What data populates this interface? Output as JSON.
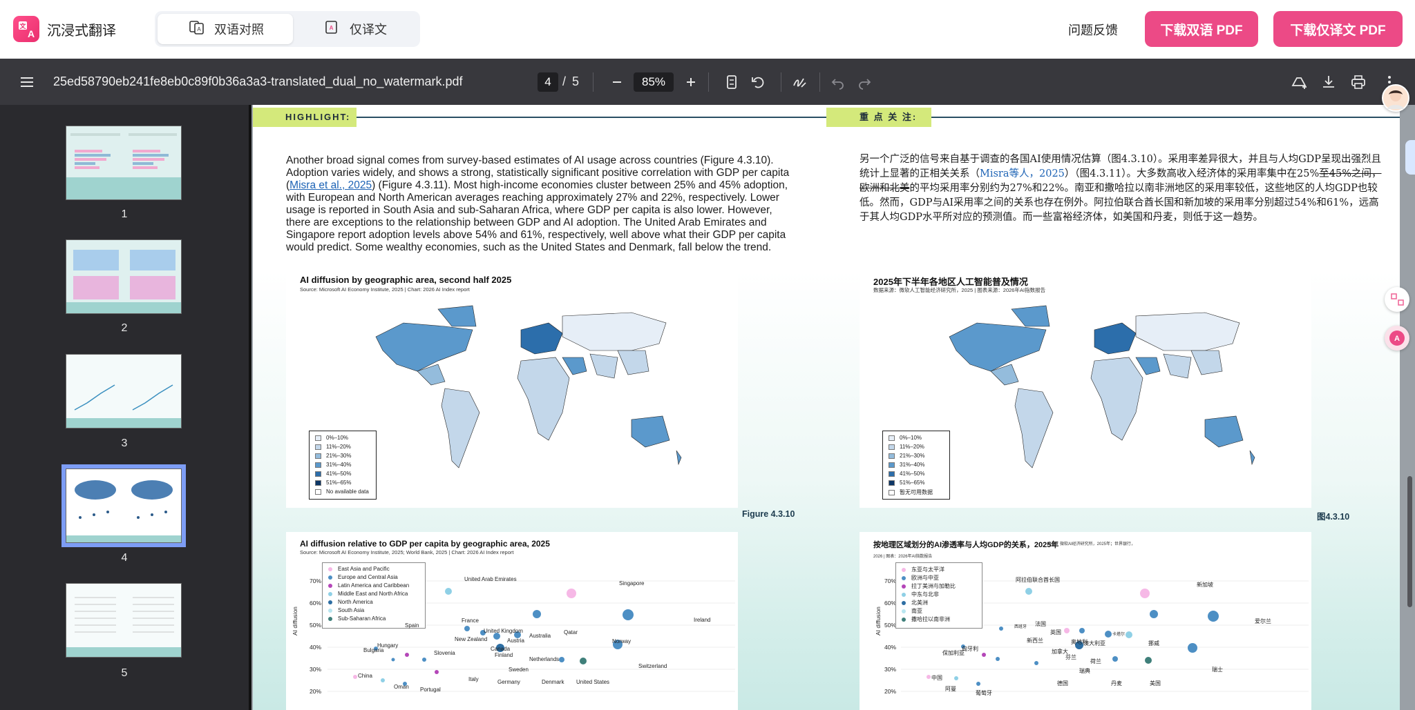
{
  "app": {
    "name": "沉浸式翻译",
    "modes": [
      {
        "label": "双语对照",
        "active": true
      },
      {
        "label": "仅译文",
        "active": false
      }
    ],
    "feedback_label": "问题反馈",
    "download_bilingual_label": "下载双语 PDF",
    "download_translated_label": "下载仅译文 PDF",
    "accent_color": "#ec4a86"
  },
  "viewer": {
    "filename": "25ed58790eb241fe8eb0c89f0b36a3a3-translated_dual_no_watermark.pdf",
    "current_page": "4",
    "page_separator": "/",
    "total_pages": "5",
    "zoom": "85%",
    "icons": [
      "menu-icon",
      "zoom-out-icon",
      "zoom-in-icon",
      "page-fit-icon",
      "rotate-icon",
      "draw-icon",
      "undo-icon",
      "redo-icon",
      "add-drive-icon",
      "download-icon",
      "print-icon",
      "more-icon"
    ]
  },
  "thumbnails": [
    {
      "label": "1",
      "selected": false
    },
    {
      "label": "2",
      "selected": false
    },
    {
      "label": "3",
      "selected": false
    },
    {
      "label": "4",
      "selected": true
    },
    {
      "label": "5",
      "selected": false
    }
  ],
  "document": {
    "highlight_en": "HIGHLIGHT:",
    "highlight_zh": "重 点 关 注:",
    "para_en": {
      "before_link": "Another broad signal comes from survey-based estimates of AI usage across countries (Figure 4.3.10). Adoption varies widely, and shows a strong, statistically significant positive correlation with GDP per capita (",
      "link": "Misra et al., 2025",
      "after_link": ") (Figure 4.3.11). Most high-income economies cluster between 25% and 45% adoption, with European and North American averages reaching approximately 27% and 22%, respectively. Lower usage is reported in South Asia and sub-Saharan Africa, where GDP per capita is also lower. However, there are exceptions to the relationship between GDP and AI adoption. The United Arab Emirates and Singapore report adoption levels above 54% and 61%, respectively, well above what their GDP per capita would predict. Some wealthy economies, such as the United States and Denmark, fall below the trend."
    },
    "para_zh": {
      "before_link": "另一个广泛的信号来自基于调查的各国AI使用情况估算（图4.3.10）。采用率差异很大，并且与人均GDP呈现出强烈且统计上显著的正相关关系（",
      "link": "Misra等人，2025",
      "middle": "）（图4.3.11）。大多数高收入经济体的采用率集中在25%",
      "struck": "至45%之间，欧洲和北美",
      "after": "的平均采用率分别约为27%和22%。南亚和撒哈拉以南非洲地区的采用率较低，这些地区的人均GDP也较低。然而，GDP与AI采用率之间的关系也存在例外。阿拉伯联合酋长国和新加坡的采用率分别超过54%和61%，远高于其人均GDP水平所对应的预测值。而一些富裕经济体，如美国和丹麦，则低于这一趋势。"
    },
    "figure_10_en": {
      "title": "AI diffusion by geographic area, second half 2025",
      "source": "Source: Microsoft AI Economy Institute, 2025 | Chart: 2026 AI Index report",
      "legend": [
        "0%–10%",
        "11%–20%",
        "21%–30%",
        "31%–40%",
        "41%–50%",
        "51%–65%",
        "No available data"
      ],
      "caption": "Figure 4.3.10"
    },
    "figure_10_zh": {
      "title": "2025年下半年各地区人工智能普及情况",
      "source": "数据来源：微软人工智能经济研究所，2025 | 图表来源：2026年AI指数报告",
      "legend": [
        "0%–10%",
        "11%–20%",
        "21%–30%",
        "31%–40%",
        "41%–50%",
        "51%–65%",
        "暂无可用数据"
      ],
      "caption": "图4.3.10"
    },
    "legend_colors": [
      "#e6eef7",
      "#c3d7ea",
      "#94bcdc",
      "#5b99cc",
      "#2c6eab",
      "#0d3666",
      "#ffffff"
    ],
    "figure_11_en": {
      "title": "AI diffusion relative to GDP per capita by geographic area, 2025",
      "source": "Source: Microsoft AI Economy Institute, 2025; World Bank, 2025 | Chart: 2026 AI Index report",
      "legend": [
        "East Asia and Pacific",
        "Europe and Central Asia",
        "Latin America and Caribbean",
        "Middle East and North Africa",
        "North America",
        "South Asia",
        "Sub-Saharan Africa"
      ],
      "ylabel": "AI diffusion",
      "yticks": [
        "70%",
        "60%",
        "50%",
        "40%",
        "30%",
        "20%"
      ],
      "labels": [
        "United Arab Emirates",
        "Singapore",
        "Ireland",
        "France",
        "Spain",
        "United Kingdom",
        "Australia",
        "Qatar",
        "New Zealand",
        "Austria",
        "Norway",
        "Hungary",
        "Canada",
        "Bulgaria",
        "Finland",
        "Slovenia",
        "Netherlands",
        "Sweden",
        "Switzerland",
        "China",
        "Italy",
        "Germany",
        "Denmark",
        "United States",
        "Oman",
        "Portugal"
      ]
    },
    "figure_11_zh": {
      "title": "按地理区域划分的AI渗透率与人均GDP的关系，2025年",
      "source": "来源：微软AI经济研究所，2025年；世界银行，",
      "source2": "2026 | 图表：2026年AI指数报告",
      "legend": [
        "东亚与太平洋",
        "欧洲与中亚",
        "拉丁美洲与加勒比",
        "中东与北非",
        "北美洲",
        "南亚",
        "撒哈拉以南非洲"
      ],
      "ylabel": "AI diffusion",
      "yticks": [
        "70%",
        "60%",
        "50%",
        "40%",
        "30%",
        "20%"
      ],
      "labels": [
        "阿拉伯联合酋长国",
        "新加坡",
        "爱尔兰",
        "西班牙",
        "法国",
        "英国",
        "新西兰",
        "澳大利亚",
        "卡塔尔",
        "奥地利",
        "挪威",
        "匈牙利",
        "保加利亚",
        "加拿大",
        "芬兰",
        "荷兰",
        "瑞典",
        "瑞士",
        "中国",
        "阿曼",
        "葡萄牙",
        "德国",
        "丹麦",
        "美国"
      ]
    },
    "region_colors": [
      "#f6b8e6",
      "#4d8fc4",
      "#b446b8",
      "#8fd0e6",
      "#2d6ea3",
      "#b8e6f0",
      "#3f7f7a"
    ]
  }
}
